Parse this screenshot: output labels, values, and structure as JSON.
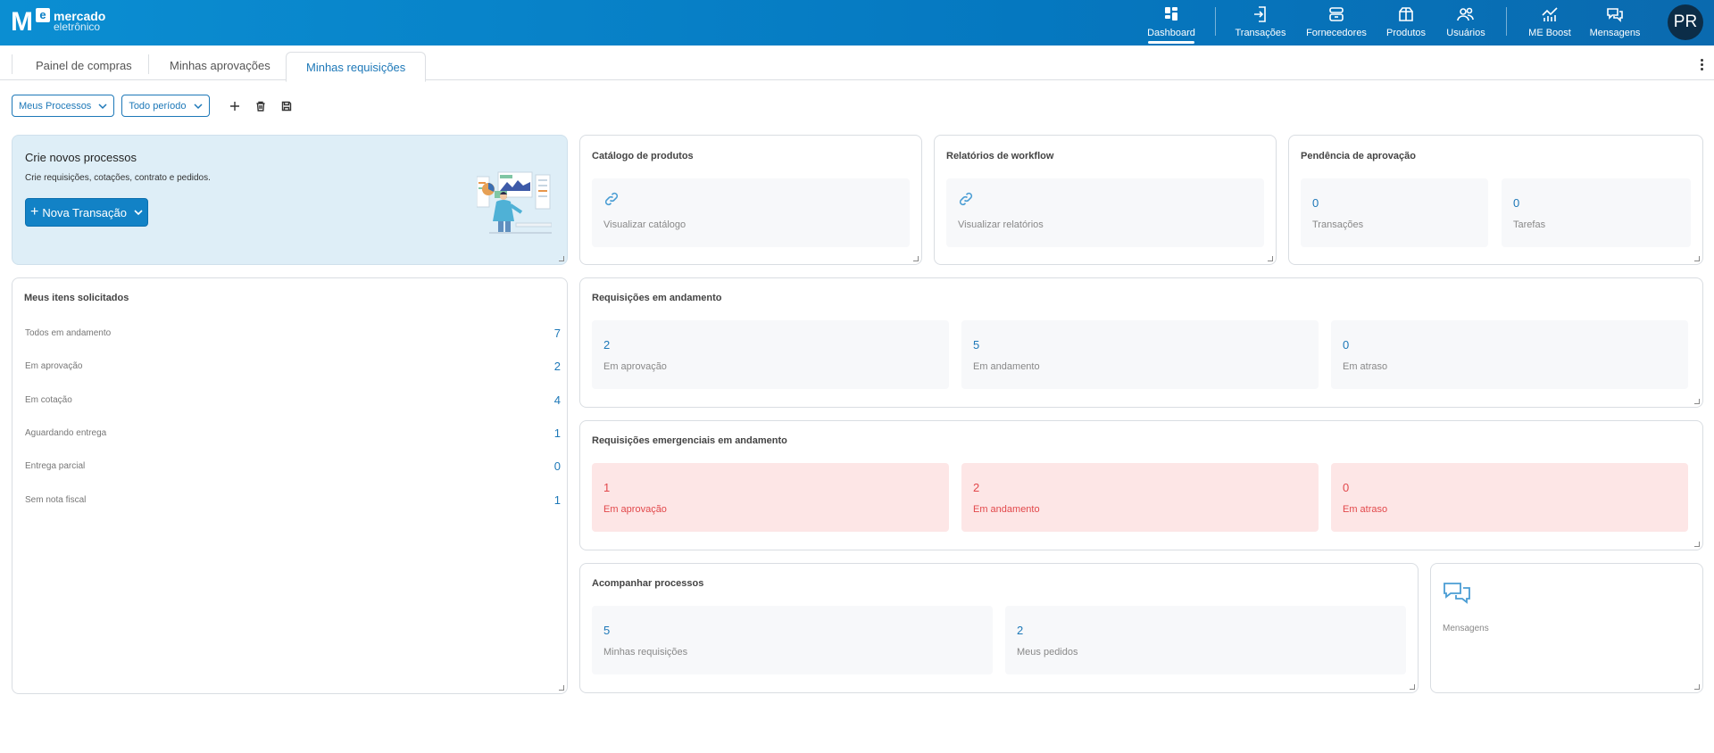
{
  "brand": {
    "line1": "mercado",
    "line2": "eletrônico",
    "mark_letter": "M",
    "mark_small": "e"
  },
  "nav": {
    "items": [
      {
        "label": "Dashboard",
        "icon": "dashboard-icon"
      },
      {
        "label": "Transações",
        "icon": "transactions-icon"
      },
      {
        "label": "Fornecedores",
        "icon": "suppliers-icon"
      },
      {
        "label": "Produtos",
        "icon": "products-icon"
      },
      {
        "label": "Usuários",
        "icon": "users-icon"
      },
      {
        "label": "ME Boost",
        "icon": "boost-chart-icon"
      },
      {
        "label": "Mensagens",
        "icon": "messages-icon"
      }
    ],
    "avatar": "PR"
  },
  "tabs": [
    "Painel de compras",
    "Minhas aprovações",
    "Minhas requisições"
  ],
  "filters": {
    "process": "Meus Processos",
    "period": "Todo período"
  },
  "hero": {
    "title": "Crie novos processos",
    "subtitle": "Crie requisições, cotações, contrato e pedidos.",
    "button": "Nova Transação"
  },
  "catalog": {
    "title": "Catálogo de produtos",
    "link": "Visualizar catálogo"
  },
  "workflow": {
    "title": "Relatórios de workflow",
    "link": "Visualizar relatórios"
  },
  "pending": {
    "title": "Pendência de aprovação",
    "tiles": [
      {
        "value": "0",
        "label": "Transações"
      },
      {
        "value": "0",
        "label": "Tarefas"
      }
    ]
  },
  "my_items": {
    "title": "Meus itens solicitados",
    "rows": [
      {
        "label": "Todos em andamento",
        "value": "7"
      },
      {
        "label": "Em aprovação",
        "value": "2"
      },
      {
        "label": "Em cotação",
        "value": "4"
      },
      {
        "label": "Aguardando entrega",
        "value": "1"
      },
      {
        "label": "Entrega parcial",
        "value": "0"
      },
      {
        "label": "Sem nota fiscal",
        "value": "1"
      }
    ]
  },
  "requests": {
    "title": "Requisições em andamento",
    "tiles": [
      {
        "value": "2",
        "label": "Em aprovação"
      },
      {
        "value": "5",
        "label": "Em andamento"
      },
      {
        "value": "0",
        "label": "Em atraso"
      }
    ]
  },
  "emergency": {
    "title": "Requisições emergenciais em andamento",
    "tiles": [
      {
        "value": "1",
        "label": "Em aprovação"
      },
      {
        "value": "2",
        "label": "Em andamento"
      },
      {
        "value": "0",
        "label": "Em atraso"
      }
    ]
  },
  "follow": {
    "title": "Acompanhar processos",
    "tiles": [
      {
        "value": "5",
        "label": "Minhas requisições"
      },
      {
        "value": "2",
        "label": "Meus pedidos"
      }
    ]
  },
  "messages": {
    "label": "Mensagens"
  },
  "colors": {
    "brand_blue": "#1282c6",
    "accent": "#1d78b8",
    "alert_red": "#e2484b",
    "alert_bg": "#fde6e6"
  }
}
